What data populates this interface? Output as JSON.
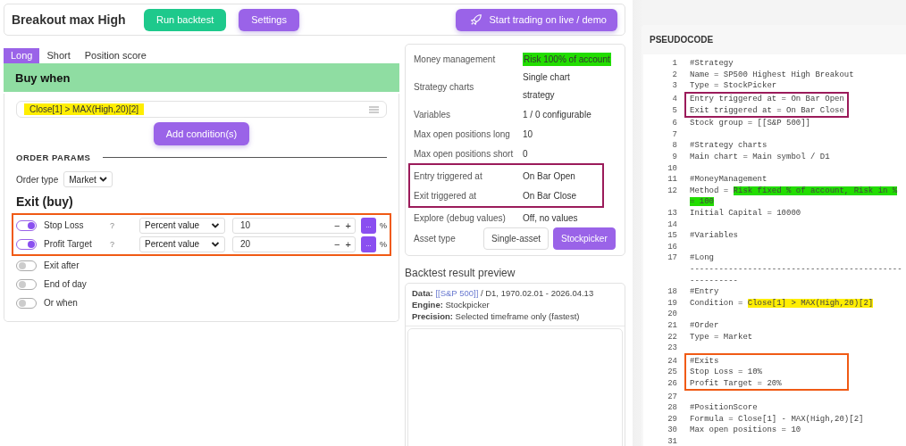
{
  "header": {
    "title": "Breakout max High",
    "run_button": "Run backtest",
    "settings_button": "Settings",
    "trade_button": "Start trading on live / demo"
  },
  "tabs": [
    {
      "label": "Long",
      "selected": true
    },
    {
      "label": "Short",
      "selected": false
    },
    {
      "label": "Position score",
      "selected": false
    }
  ],
  "buy_when": {
    "title": "Buy when",
    "condition": "Close[1] > MAX(High,20)[2]",
    "add_button": "Add condition(s)"
  },
  "order_params": {
    "title": "ORDER PARAMS",
    "order_type_label": "Order type",
    "order_type": "Market"
  },
  "exit": {
    "title": "Exit (buy)",
    "groups": [
      {
        "color": "#f05a14",
        "rows": [
          {
            "kind": "value",
            "label": "Stop Loss",
            "on": true,
            "help": "?",
            "mode": "Percent value",
            "value": "10",
            "minus": "−",
            "plus": "+",
            "more": "...",
            "unit": "%"
          },
          {
            "kind": "value",
            "label": "Profit Target",
            "on": true,
            "help": "?",
            "mode": "Percent value",
            "value": "20",
            "minus": "−",
            "plus": "+",
            "more": "...",
            "unit": "%"
          }
        ]
      },
      {
        "rows": [
          {
            "kind": "plain",
            "label": "Exit after",
            "on": false
          },
          {
            "kind": "plain",
            "label": "End of day",
            "on": false
          },
          {
            "kind": "plain",
            "label": "Or when",
            "on": false
          }
        ]
      }
    ]
  },
  "summary": {
    "groups": [
      {
        "rows": [
          {
            "label": "Money management",
            "value": "Risk 100% of account",
            "color": "#22dd00"
          },
          {
            "label": "Strategy charts",
            "value": "Single chart strategy"
          },
          {
            "label": "Variables",
            "value": "1 / 0 configurable"
          },
          {
            "label": "Max open positions long",
            "value": "10"
          },
          {
            "label": "Max open positions short",
            "value": "0"
          }
        ]
      },
      {
        "color": "#9b1b5a",
        "rows": [
          {
            "label": "Entry triggered at",
            "value": "On Bar Open"
          },
          {
            "label": "Exit triggered at",
            "value": "On Bar Close"
          }
        ]
      },
      {
        "rows": [
          {
            "label": "Explore (debug values)",
            "value": "Off, no values"
          }
        ]
      }
    ],
    "asset_type": {
      "label": "Asset type",
      "options": [
        {
          "label": "Single-asset",
          "selected": false
        },
        {
          "label": "Stockpicker",
          "selected": true
        }
      ]
    }
  },
  "preview": {
    "title": "Backtest result preview",
    "lines": [
      {
        "label": "Data:",
        "link": "[[S&P 500]]",
        "text": " / D1, 1970.02.01 - 2026.04.13"
      },
      {
        "label": "Engine:",
        "text": " Stockpicker"
      },
      {
        "label": "Precision:",
        "text": " Selected timeframe only (fastest)"
      }
    ]
  },
  "pseudocode": {
    "title": "PSEUDOCODE",
    "groups": [
      {
        "lines": [
          {
            "num": "1",
            "text": "#Strategy"
          },
          {
            "num": "2",
            "text": "Name = SP500 Highest High Breakout"
          },
          {
            "num": "3",
            "text": "Type = StockPicker"
          }
        ]
      },
      {
        "color": "#9b1b5a",
        "lines": [
          {
            "num": "4",
            "text": "Entry triggered at = On Bar Open"
          },
          {
            "num": "5",
            "text": "Exit triggered at = On Bar Close"
          }
        ]
      },
      {
        "lines": [
          {
            "num": "6",
            "text": "Stock group = [[S&P 500]]"
          },
          {
            "num": "7"
          },
          {
            "num": "8",
            "text": "#Strategy charts"
          },
          {
            "num": "9",
            "text": "Main chart = Main symbol / D1"
          },
          {
            "num": "10"
          },
          {
            "num": "11",
            "text": "#MoneyManagement"
          },
          {
            "num": "12",
            "text": "Method = ",
            "highlight": "Risk fixed % of account, Risk in %",
            "color": "#22dd00"
          },
          {
            "highlight": "= 100",
            "color": "#22dd00"
          },
          {
            "num": "13",
            "text": "Initial Capital = 10000"
          },
          {
            "num": "14"
          },
          {
            "num": "15",
            "text": "#Variables"
          },
          {
            "num": "16"
          },
          {
            "num": "17",
            "text": "#Long"
          },
          {
            "text": "--------------------------------------------"
          },
          {
            "text": "----------"
          },
          {
            "num": "18",
            "text": "#Entry"
          },
          {
            "num": "19",
            "text": "Condition = ",
            "highlight": "Close[1] > MAX(High,20)[2]",
            "color": "#ffee00"
          },
          {
            "num": "20"
          },
          {
            "num": "21",
            "text": "#Order"
          },
          {
            "num": "22",
            "text": "Type = Market"
          },
          {
            "num": "23"
          }
        ]
      },
      {
        "color": "#f05a14",
        "lines": [
          {
            "num": "24",
            "text": "#Exits"
          },
          {
            "num": "25",
            "text": "Stop Loss = 10%"
          },
          {
            "num": "26",
            "text": "Profit Target = 20%"
          }
        ]
      },
      {
        "lines": [
          {
            "num": "27"
          },
          {
            "num": "28",
            "text": "#PositionScore"
          },
          {
            "num": "29",
            "text": "Formula = Close[1] - MAX(High,20)[2]"
          },
          {
            "num": "30",
            "text": "Max open positions = 10"
          },
          {
            "num": "31"
          }
        ]
      }
    ]
  }
}
